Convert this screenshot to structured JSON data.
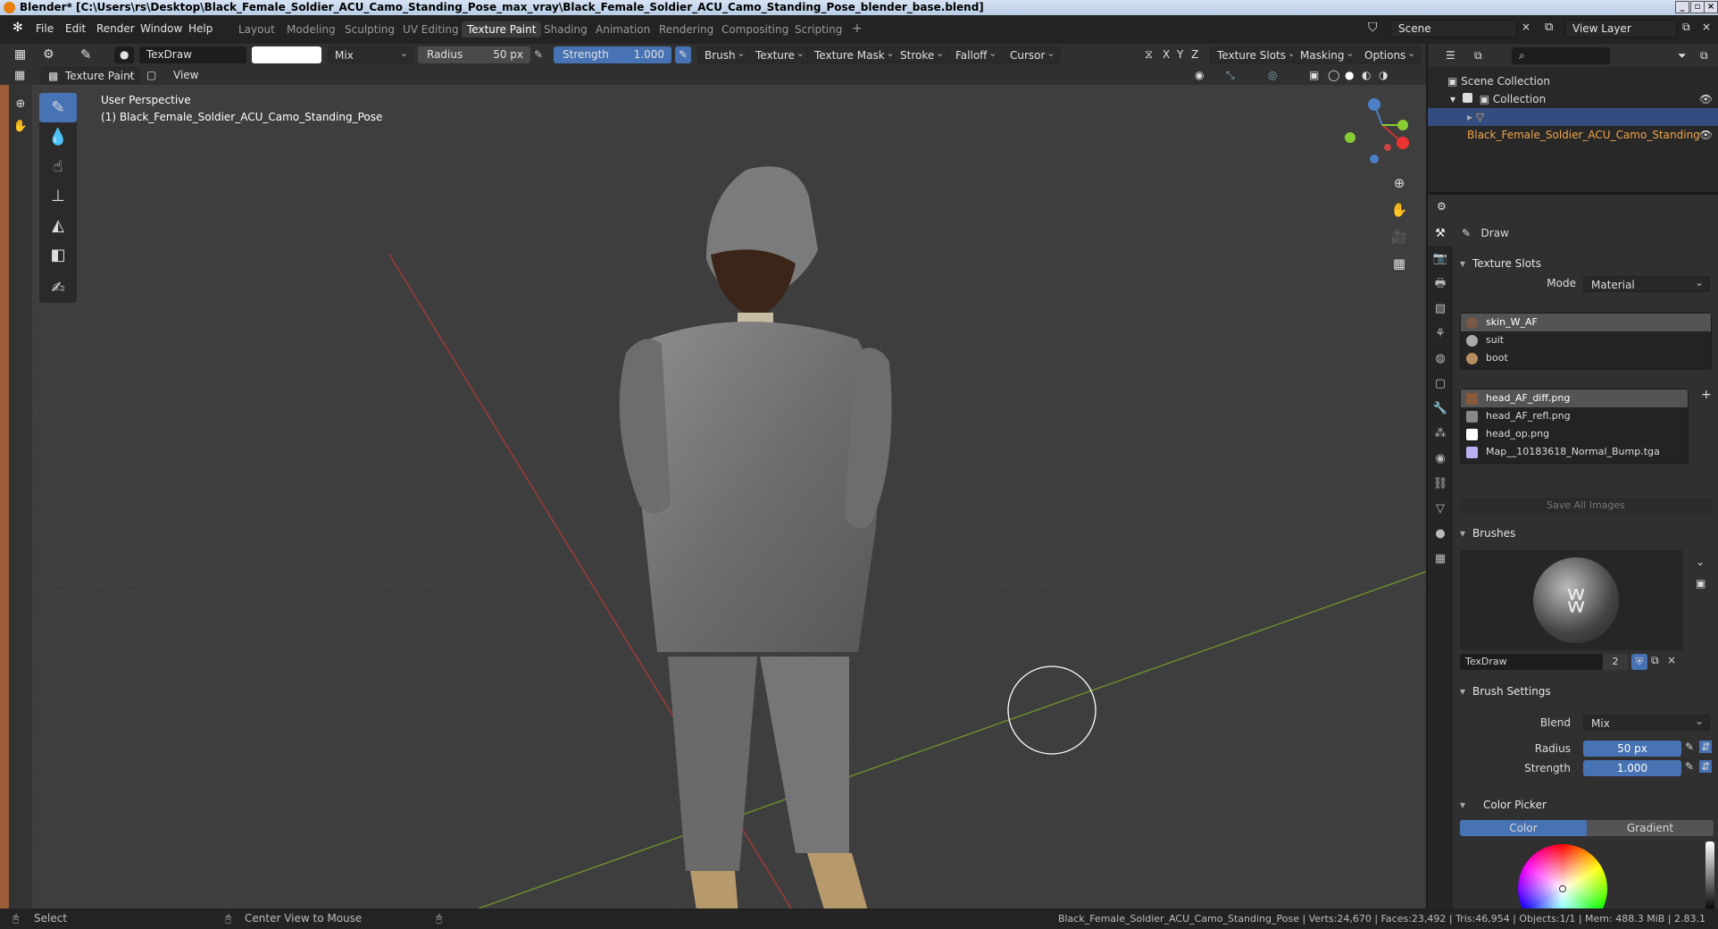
{
  "window": {
    "title": "Blender* [C:\\Users\\rs\\Desktop\\Black_Female_Soldier_ACU_Camo_Standing_Pose_max_vray\\Black_Female_Soldier_ACU_Camo_Standing_Pose_blender_base.blend]"
  },
  "menu": {
    "file": "File",
    "edit": "Edit",
    "render": "Render",
    "window": "Window",
    "help": "Help"
  },
  "workspaces": [
    "Layout",
    "Modeling",
    "Sculpting",
    "UV Editing",
    "Texture Paint",
    "Shading",
    "Animation",
    "Rendering",
    "Compositing",
    "Scripting"
  ],
  "scene": {
    "name": "Scene",
    "view_layer": "View Layer"
  },
  "tool_header": {
    "brush_name": "TexDraw",
    "blend": "Mix",
    "radius_label": "Radius",
    "radius_value": "50 px",
    "strength_label": "Strength",
    "strength_value": "1.000",
    "brush": "Brush",
    "texture": "Texture",
    "texture_mask": "Texture Mask",
    "stroke": "Stroke",
    "falloff": "Falloff",
    "cursor": "Cursor",
    "x": "X",
    "y": "Y",
    "z": "Z",
    "texture_slots": "Texture Slots",
    "masking": "Masking",
    "options": "Options"
  },
  "mode_header": {
    "mode": "Texture Paint",
    "view": "View"
  },
  "viewport": {
    "perspective": "User Perspective",
    "object": "(1) Black_Female_Soldier_ACU_Camo_Standing_Pose"
  },
  "outliner": {
    "scene_collection": "Scene Collection",
    "collection": "Collection",
    "object": "Black_Female_Soldier_ACU_Camo_Standing"
  },
  "properties": {
    "tool_name": "Draw",
    "texture_slots_title": "Texture Slots",
    "mode_label": "Mode",
    "mode_value": "Material",
    "materials": [
      "skin_W_AF",
      "suit",
      "boot"
    ],
    "images": [
      "head_AF_diff.png",
      "head_AF_refl.png",
      "head_op.png",
      "Map__10183618_Normal_Bump.tga"
    ],
    "save_all": "Save All Images",
    "brushes_title": "Brushes",
    "brush_name": "TexDraw",
    "brush_users": "2",
    "brush_settings_title": "Brush Settings",
    "blend_label": "Blend",
    "blend_value": "Mix",
    "radius_label": "Radius",
    "radius_value": "50 px",
    "strength_label": "Strength",
    "strength_value": "1.000",
    "color_picker_title": "Color Picker",
    "color_tab": "Color",
    "gradient_tab": "Gradient"
  },
  "status": {
    "select": "Select",
    "center_view": "Center View to Mouse",
    "stats": "Black_Female_Soldier_ACU_Camo_Standing_Pose | Verts:24,670 | Faces:23,492 | Tris:46,954 | Objects:1/1 | Mem: 488.3 MiB | 2.83.1"
  },
  "colors": {
    "accent": "#4772b3",
    "header": "#303030",
    "viewport": "#3e3e3e",
    "selected_object": "#f0a64b"
  }
}
